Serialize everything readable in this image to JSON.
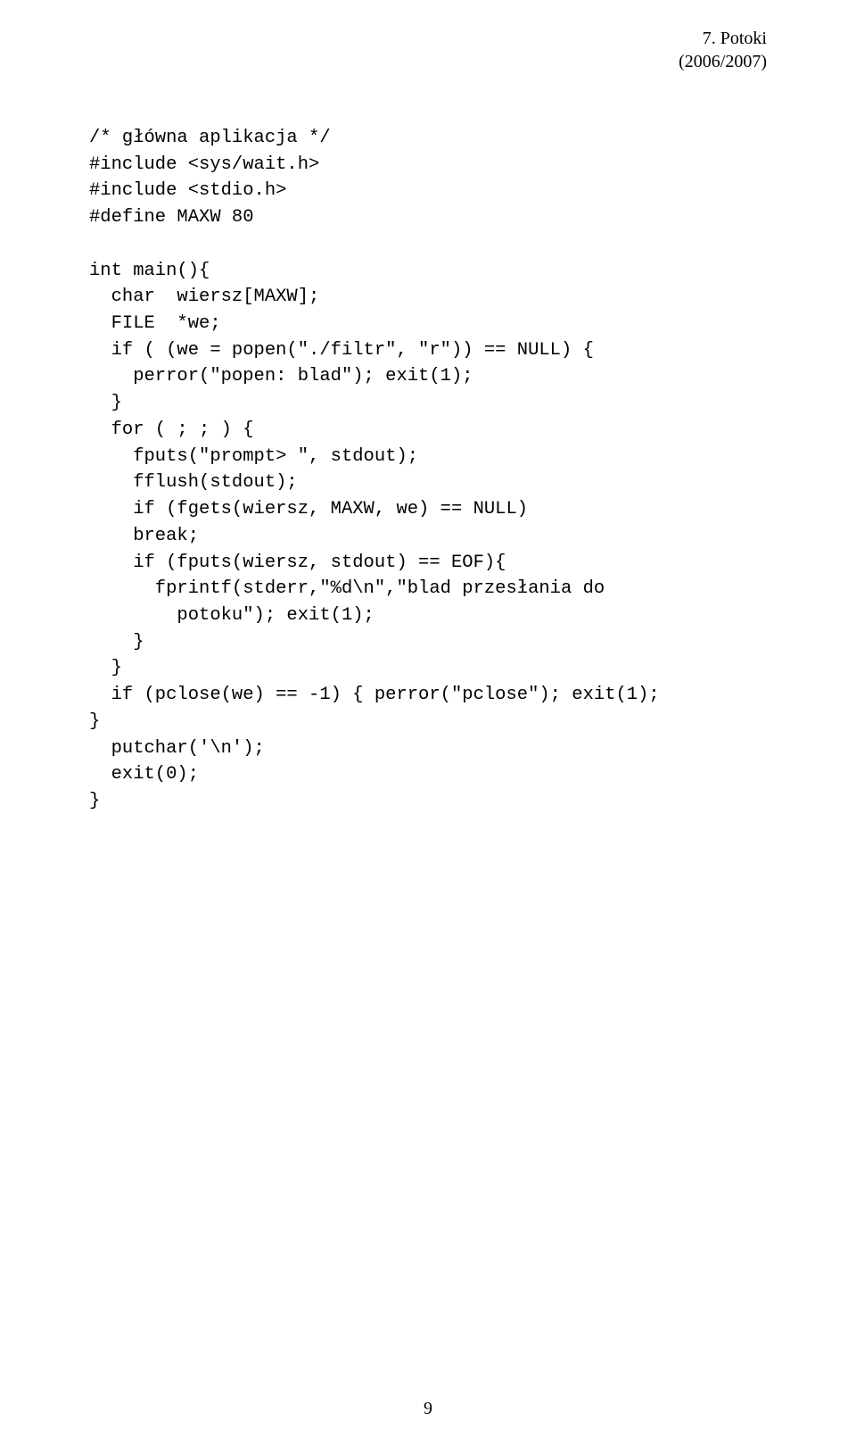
{
  "header": {
    "line1": "7. Potoki",
    "line2": "(2006/2007)"
  },
  "code": "/* główna aplikacja */\n#include <sys/wait.h>\n#include <stdio.h>\n#define MAXW 80\n\nint main(){\n  char  wiersz[MAXW];\n  FILE  *we;\n  if ( (we = popen(\"./filtr\", \"r\")) == NULL) {\n    perror(\"popen: blad\"); exit(1);\n  }\n  for ( ; ; ) {\n    fputs(\"prompt> \", stdout);\n    fflush(stdout);\n    if (fgets(wiersz, MAXW, we) == NULL)\n    break;\n    if (fputs(wiersz, stdout) == EOF){\n      fprintf(stderr,\"%d\\n\",\"blad przesłania do\n        potoku\"); exit(1);\n    }\n  }\n  if (pclose(we) == -1) { perror(\"pclose\"); exit(1);\n}\n  putchar('\\n');\n  exit(0);\n}",
  "pageNumber": "9"
}
